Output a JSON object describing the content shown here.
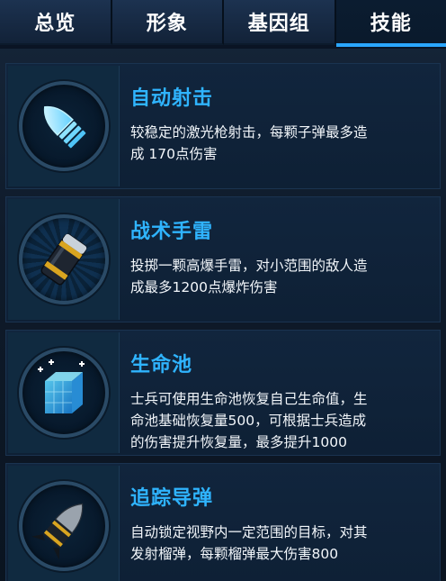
{
  "tabs": [
    {
      "label": "总览",
      "active": false
    },
    {
      "label": "形象",
      "active": false
    },
    {
      "label": "基因组",
      "active": false
    },
    {
      "label": "技能",
      "active": true
    }
  ],
  "skills": [
    {
      "title": "自动射击",
      "desc_lines": [
        "较稳定的激光枪射击，每颗子弹最多造",
        "成 170点伤害"
      ],
      "icon": "bullet-icon"
    },
    {
      "title": "战术手雷",
      "desc_lines": [
        "投掷一颗高爆手雷，对小范围的敌人造",
        "成最多1200点爆炸伤害"
      ],
      "icon": "grenade-icon"
    },
    {
      "title": "生命池",
      "desc_lines": [
        "士兵可使用生命池恢复自己生命值，生",
        "命池基础恢复量500，可根据士兵造成",
        "的伤害提升恢复量，最多提升1000"
      ],
      "icon": "health-cube-icon"
    },
    {
      "title": "追踪导弹",
      "desc_lines": [
        "自动锁定视野内一定范围的目标，对其",
        "发射榴弹，每颗榴弹最大伤害800"
      ],
      "icon": "missile-icon"
    }
  ],
  "colors": {
    "accent": "#2fb4ff",
    "tab_underline": "#2aa6ff",
    "card_bg": "#11253d"
  }
}
